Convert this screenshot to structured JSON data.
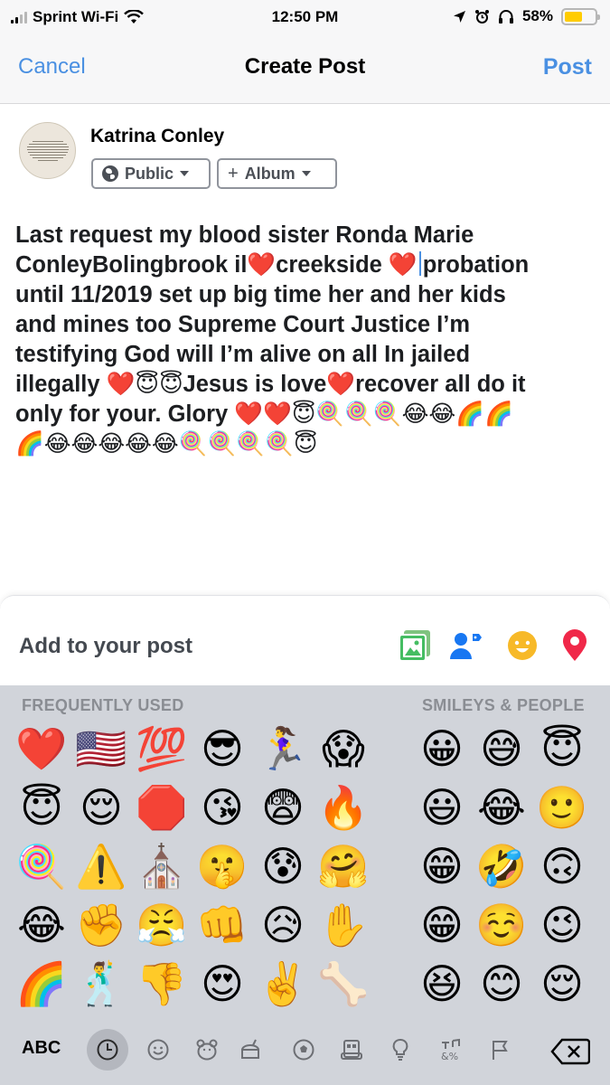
{
  "status_bar": {
    "carrier": "Sprint Wi-Fi",
    "time": "12:50 PM",
    "battery_percent": "58%",
    "battery_level": 0.58,
    "battery_color": "#ffcc00"
  },
  "nav": {
    "cancel_label": "Cancel",
    "title": "Create Post",
    "post_label": "Post",
    "accent_color": "#4a90e2"
  },
  "composer": {
    "user_name": "Katrina Conley",
    "audience_label": "Public",
    "album_label": "Album",
    "text_lines": [
      "Last request my blood sister Ronda Marie",
      "ConleyBolingbrook il❤️creekside ❤️",
      "probation",
      "until 11/2019 set up big time her and her kids",
      "and mines too Supreme Court Justice I’m",
      "testifying God will I’m alive on all In jailed",
      "illegally ❤️😇😇Jesus is love❤️recover all do it",
      "only for your. Glory ❤️❤️😇🍭🍭🍭😂😂🌈🌈",
      "🌈😂😂😂😂😂🍭🍭🍭🍭😇"
    ]
  },
  "add_to_post": {
    "label": "Add to your post",
    "icons": [
      "photo-icon",
      "tag-people-icon",
      "feeling-icon",
      "location-icon"
    ]
  },
  "keyboard": {
    "frequently_used_label": "FREQUENTLY USED",
    "smileys_label": "SMILEYS & PEOPLE",
    "frequently_used": [
      [
        "❤️",
        "😇",
        "🍭",
        "😂",
        "🌈"
      ],
      [
        "🇺🇸",
        "😌",
        "⚠️",
        "✊",
        "🕺"
      ],
      [
        "💯",
        "🛑",
        "⛪",
        "😤",
        "👎"
      ],
      [
        "😎",
        "😘",
        "🤫",
        "👊",
        "😍"
      ],
      [
        "🏃‍♀️",
        "😨",
        "😰",
        "😥",
        "✌️"
      ],
      [
        "😱",
        "🔥",
        "🤗",
        "✋",
        "🦴"
      ]
    ],
    "smileys": [
      [
        "😀",
        "😃",
        "😁",
        "😁",
        "😆"
      ],
      [
        "😅",
        "😂",
        "🤣",
        "☺️",
        "😊"
      ],
      [
        "😇",
        "🙂",
        "🙃",
        "😉",
        "😌"
      ]
    ],
    "abc_label": "ABC",
    "categories": [
      "recent-icon",
      "smiley-category-icon",
      "animal-category-icon",
      "food-category-icon",
      "activity-category-icon",
      "travel-category-icon",
      "objects-category-icon",
      "symbols-category-icon",
      "flags-category-icon"
    ]
  }
}
